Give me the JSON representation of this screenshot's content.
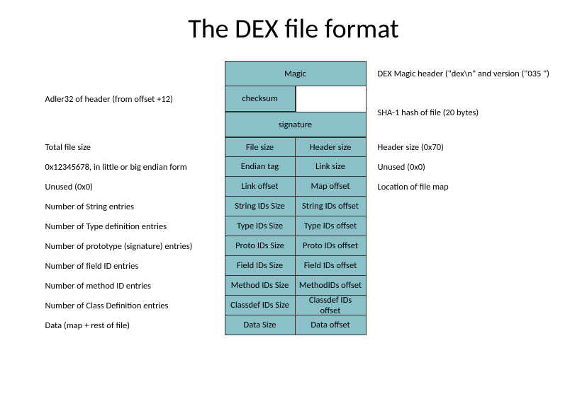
{
  "title": "The DEX file format",
  "rows": [
    {
      "left": "",
      "cells": [
        "Magic"
      ],
      "right": "DEX Magic header (\"dex\\n\"  and version (\"035 \")",
      "full": true,
      "height": "h36"
    },
    {
      "left": "Adler32 of header (from offset +12)",
      "cells": [
        "checksum"
      ],
      "right": "",
      "half_left_only": true,
      "height": "h36"
    },
    {
      "left": "",
      "cells": [
        "signature"
      ],
      "right": "SHA-1 hash of file (20 bytes)",
      "full": true,
      "height": "h36",
      "right_valign": "top"
    },
    {
      "left": "Total file size",
      "cells": [
        "File size",
        "Header size"
      ],
      "right": "Header size (0x70)",
      "height": "h30"
    },
    {
      "left": "0x12345678, in little or big endian form",
      "cells": [
        "Endian tag",
        "Link size"
      ],
      "right": "Unused (0x0)",
      "height": "h30"
    },
    {
      "left": "Unused (0x0)",
      "cells": [
        "Link offset",
        "Map offset"
      ],
      "right": "Location of file map",
      "height": "h30"
    },
    {
      "left": "Number of String entries",
      "cells": [
        "String IDs Size",
        "String IDs offset"
      ],
      "right": "",
      "height": "h30"
    },
    {
      "left": "Number of Type definition entries",
      "cells": [
        "Type IDs Size",
        "Type IDs offset"
      ],
      "right": "",
      "height": "h30"
    },
    {
      "left": "Number of prototype (signature) entries)",
      "cells": [
        "Proto IDs Size",
        "Proto IDs offset"
      ],
      "right": "",
      "height": "h30"
    },
    {
      "left": "Number of field ID entries",
      "cells": [
        "Field IDs Size",
        "Field IDs offset"
      ],
      "right": "",
      "height": "h30"
    },
    {
      "left": "Number of method ID entries",
      "cells": [
        "Method IDs Size",
        "MethodIDs offset"
      ],
      "right": "",
      "height": "h30"
    },
    {
      "left": "Number of Class Definition entries",
      "cells": [
        "Classdef IDs Size",
        "Classdef IDs offset"
      ],
      "right": "",
      "height": "h30"
    },
    {
      "left": "Data (map + rest of file)",
      "cells": [
        "Data Size",
        "Data offset"
      ],
      "right": "",
      "height": "h30"
    }
  ]
}
